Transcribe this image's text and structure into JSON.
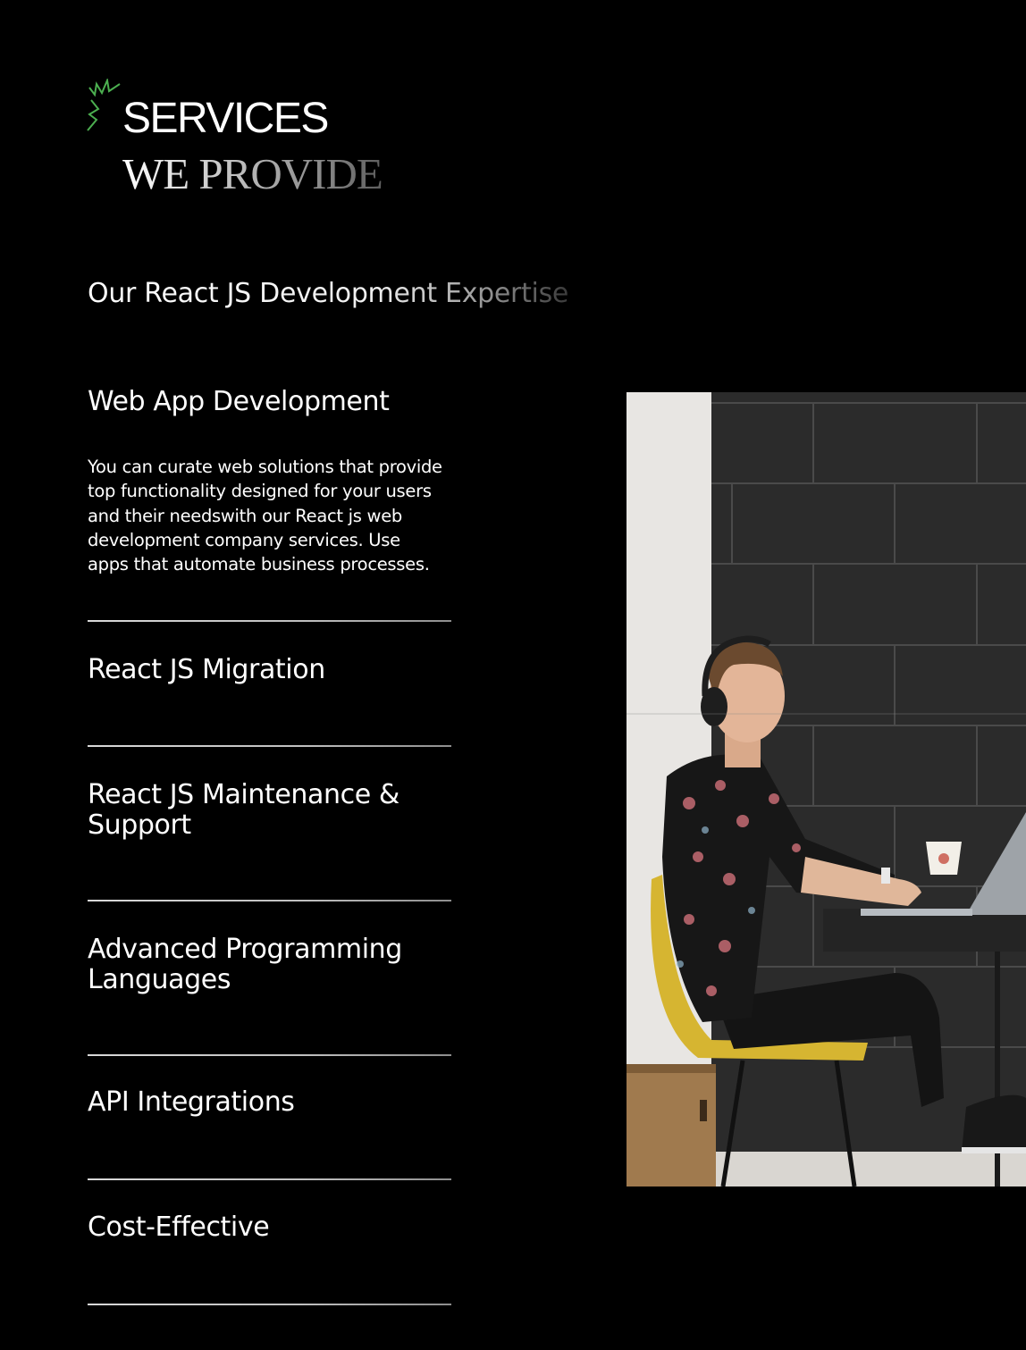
{
  "header": {
    "title_line1": "SERVICES",
    "title_line2": "WE PROVIDE",
    "icon": "spark-icon",
    "accent_color": "#4caf50"
  },
  "subtitle": "Our React JS Development Expertise",
  "services": [
    {
      "title": "Web App Development",
      "description": "You can curate web solutions that provide top functionality designed for your users and their needswith our React js web development company services. Use apps that automate business processes.",
      "expanded": true
    },
    {
      "title": "React JS Migration",
      "expanded": false
    },
    {
      "title": "React JS Maintenance & Support",
      "expanded": false
    },
    {
      "title": "Advanced Programming Languages",
      "expanded": false
    },
    {
      "title": "API Integrations",
      "expanded": false
    },
    {
      "title": "Cost-Effective",
      "expanded": false
    }
  ],
  "image": {
    "name": "developer-photo",
    "colors": {
      "wall": "#2b2b2b",
      "chair": "#d6b531",
      "desk": "#242424"
    }
  }
}
